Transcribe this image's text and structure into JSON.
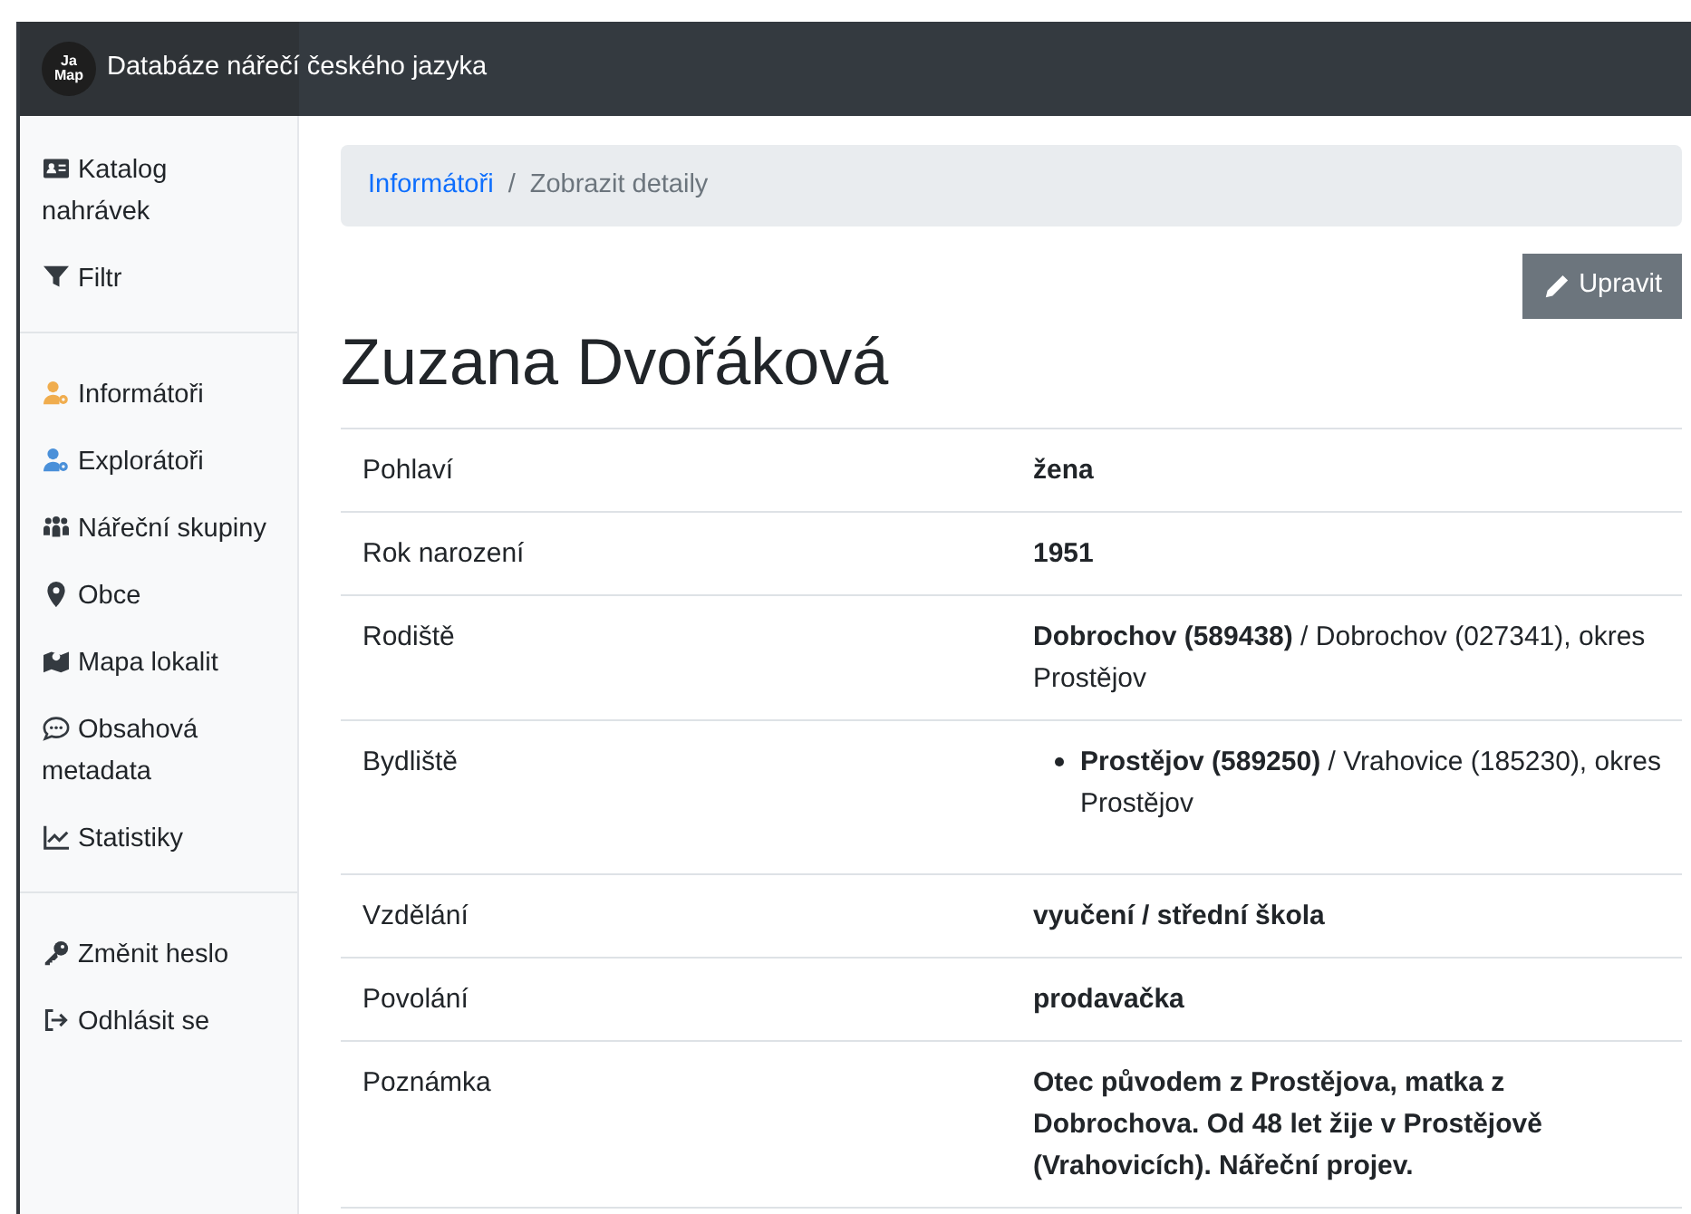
{
  "header": {
    "logo_line_1": "Ja",
    "logo_line_2": "Map",
    "title": "Databáze nářečí českého jazyka"
  },
  "sidebar": {
    "groups": [
      [
        {
          "label": "Katalog nahrávek",
          "color": "#343a40"
        },
        {
          "label": "Filtr",
          "color": "#343a40"
        }
      ],
      [
        {
          "label": "Informátoři",
          "color": "#f0ad4e"
        },
        {
          "label": "Explorátoři",
          "color": "#4a90d9"
        },
        {
          "label": "Nářeční skupiny",
          "color": "#343a40"
        },
        {
          "label": "Obce",
          "color": "#343a40"
        },
        {
          "label": "Mapa lokalit",
          "color": "#343a40"
        },
        {
          "label": "Obsahová metadata",
          "color": "#343a40"
        },
        {
          "label": "Statistiky",
          "color": "#343a40"
        }
      ],
      [
        {
          "label": "Změnit heslo",
          "color": "#343a40"
        },
        {
          "label": "Odhlásit se",
          "color": "#343a40"
        }
      ]
    ]
  },
  "breadcrumb": [
    {
      "label": "Informátoři",
      "link": true
    },
    {
      "separator": "/",
      "label": "Zobrazit detaily",
      "link": false
    }
  ],
  "edit_button": "Upravit",
  "heading": "Zuzana Dvořáková",
  "rows": [
    {
      "label": "Pohlaví",
      "kind": "text",
      "bold": true,
      "value": "žena"
    },
    {
      "label": "Rok narození",
      "kind": "text",
      "bold": true,
      "value": "1951"
    },
    {
      "label": "Rodiště",
      "kind": "text",
      "bold": false,
      "value": "**Dobrochov (589438)** / Dobrochov (027341), okres Prostějov"
    },
    {
      "label": "Bydliště",
      "kind": "list",
      "bold": false,
      "items": [
        "**Prostějov (589250)** / Vrahovice (185230), okres Prostějov"
      ]
    },
    {
      "label": "Vzdělání",
      "kind": "text",
      "bold": true,
      "value": "vyučení / střední škola"
    },
    {
      "label": "Povolání",
      "kind": "text",
      "bold": true,
      "value": "prodavačka"
    },
    {
      "label": "Poznámka",
      "kind": "text",
      "bold": true,
      "value": "Otec původem z Prostějova, matka z Dobrochova. Od 48 let žije v Prostějově (Vrahovicích). Nářeční projev."
    }
  ]
}
